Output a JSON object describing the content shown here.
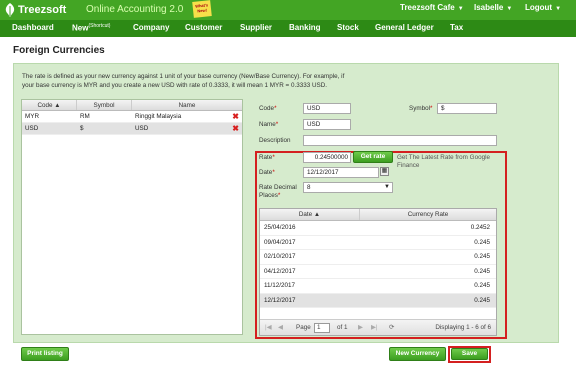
{
  "header": {
    "brand": "Treezsoft",
    "app_name": "Online Accounting 2.0",
    "badge": "What's New!",
    "company": "Treezsoft Cafe",
    "user": "Isabelle",
    "logout": "Logout"
  },
  "nav": {
    "items": [
      {
        "label": "Dashboard"
      },
      {
        "label": "New",
        "sup": "(Shortcut)"
      },
      {
        "label": "Company"
      },
      {
        "label": "Customer"
      },
      {
        "label": "Supplier"
      },
      {
        "label": "Banking"
      },
      {
        "label": "Stock"
      },
      {
        "label": "General Ledger"
      },
      {
        "label": "Tax"
      }
    ]
  },
  "page_title": "Foreign Currencies",
  "intro_line1": "The rate is defined as your new currency against 1 unit of your base currency (New/Base Currency). For example, if",
  "intro_line2": "your base currency is MYR and you create a new USD with rate of 0.3333, it will mean 1 MYR = 0.3333 USD.",
  "currency_grid": {
    "columns": {
      "code": "Code ▲",
      "symbol": "Symbol",
      "name": "Name"
    },
    "rows": [
      {
        "code": "MYR",
        "symbol": "RM",
        "name": "Ringgit Malaysia"
      },
      {
        "code": "USD",
        "symbol": "$",
        "name": "USD"
      }
    ]
  },
  "form": {
    "code_label": "Code",
    "code_value": "USD",
    "symbol_label": "Symbol",
    "symbol_value": "$",
    "name_label": "Name",
    "name_value": "USD",
    "description_label": "Description",
    "description_value": "",
    "rate_label": "Rate",
    "rate_value": "0.24500000",
    "get_rate_button": "Get rate",
    "rate_note": "Get The Latest Rate from Google Finance",
    "date_label": "Date",
    "date_value": "12/12/2017",
    "decimal_label_1": "Rate Decimal",
    "decimal_label_2": "Places",
    "decimal_value": "8",
    "required_mark": "*"
  },
  "rate_grid": {
    "columns": {
      "date": "Date ▲",
      "rate": "Currency Rate"
    },
    "rows": [
      {
        "date": "25/04/2016",
        "rate": "0.2452"
      },
      {
        "date": "09/04/2017",
        "rate": "0.245"
      },
      {
        "date": "02/10/2017",
        "rate": "0.245"
      },
      {
        "date": "04/12/2017",
        "rate": "0.245"
      },
      {
        "date": "11/12/2017",
        "rate": "0.245"
      },
      {
        "date": "12/12/2017",
        "rate": "0.245"
      }
    ],
    "pager": {
      "page_label": "Page",
      "page_value": "1",
      "of_label": "of 1",
      "display_text": "Displaying 1 - 6 of 6"
    }
  },
  "buttons": {
    "print_listing": "Print listing",
    "new_currency": "New Currency",
    "save": "Save"
  },
  "colors": {
    "header_green": "#43a524",
    "nav_green": "#2d8a15",
    "panel_green": "#d6ebcd",
    "highlight_red": "#d42020"
  }
}
